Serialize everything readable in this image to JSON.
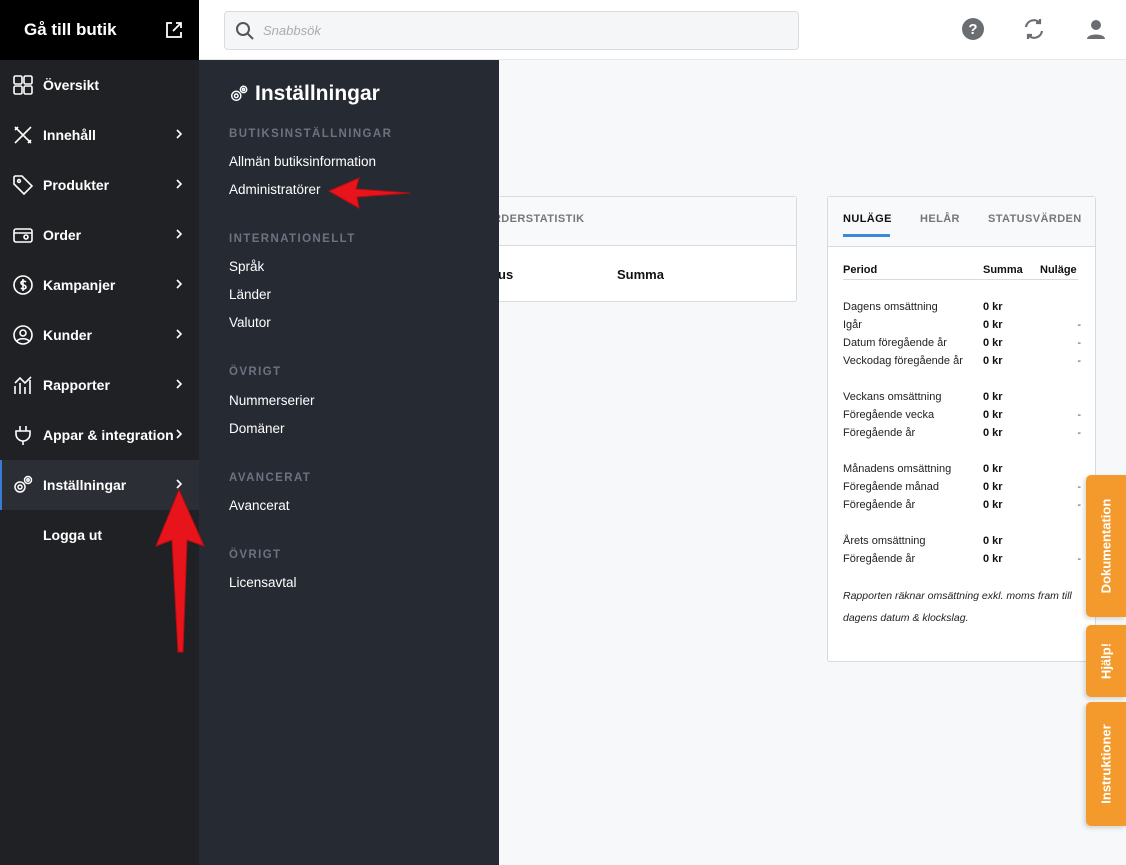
{
  "sidebar": {
    "store_link": "Gå till butik",
    "items": [
      {
        "label": "Översikt",
        "icon": "dashboard-icon",
        "has_chevron": false
      },
      {
        "label": "Innehåll",
        "icon": "pencil-ruler-icon",
        "has_chevron": true
      },
      {
        "label": "Produkter",
        "icon": "tag-icon",
        "has_chevron": true
      },
      {
        "label": "Order",
        "icon": "wallet-icon",
        "has_chevron": true
      },
      {
        "label": "Kampanjer",
        "icon": "dollar-badge-icon",
        "has_chevron": true
      },
      {
        "label": "Kunder",
        "icon": "user-circle-icon",
        "has_chevron": true
      },
      {
        "label": "Rapporter",
        "icon": "chart-icon",
        "has_chevron": true
      },
      {
        "label": "Appar & integration",
        "icon": "plug-icon",
        "has_chevron": true
      },
      {
        "label": "Inställningar",
        "icon": "gears-icon",
        "has_chevron": true,
        "active": true
      },
      {
        "label": "Logga ut",
        "icon": "",
        "has_chevron": false
      }
    ]
  },
  "search": {
    "placeholder": "Snabbsök"
  },
  "topbar_icons": [
    "help-icon",
    "sync-icon",
    "user-icon"
  ],
  "settings_menu": {
    "title": "Inställningar",
    "sections": [
      {
        "heading": "BUTIKSINSTÄLLNINGAR",
        "links": [
          "Allmän butiksinformation",
          "Administratörer"
        ]
      },
      {
        "heading": "INTERNATIONELLT",
        "links": [
          "Språk",
          "Länder",
          "Valutor"
        ]
      },
      {
        "heading": "ÖVRIGT",
        "links": [
          "Nummerserier",
          "Domäner"
        ]
      },
      {
        "heading": "AVANCERAT",
        "links": [
          "Avancerat"
        ]
      },
      {
        "heading": "ÖVRIGT",
        "links": [
          "Licensavtal"
        ]
      }
    ]
  },
  "order_stats": {
    "tab": "ORDERSTATISTIK",
    "columns": [
      "us",
      "Summa"
    ]
  },
  "sales_card": {
    "tabs": [
      "NULÄGE",
      "HELÅR",
      "STATUSVÄRDEN"
    ],
    "columns": [
      "Period",
      "Summa",
      "Nuläge"
    ],
    "rows": [
      {
        "label": "Dagens omsättning",
        "sum": "0 kr",
        "current": ""
      },
      {
        "label": "Igår",
        "sum": "0 kr",
        "current": "-"
      },
      {
        "label": "Datum föregående år",
        "sum": "0 kr",
        "current": "-"
      },
      {
        "label": "Veckodag föregående år",
        "sum": "0 kr",
        "current": "-"
      },
      {
        "label": "Veckans omsättning",
        "sum": "0 kr",
        "current": ""
      },
      {
        "label": "Föregående vecka",
        "sum": "0 kr",
        "current": "-"
      },
      {
        "label": "Föregående år",
        "sum": "0 kr",
        "current": "-"
      },
      {
        "label": "Månadens omsättning",
        "sum": "0 kr",
        "current": ""
      },
      {
        "label": "Föregående månad",
        "sum": "0 kr",
        "current": "-"
      },
      {
        "label": "Föregående år",
        "sum": "0 kr",
        "current": "-"
      },
      {
        "label": "Årets omsättning",
        "sum": "0 kr",
        "current": ""
      },
      {
        "label": "Föregående år",
        "sum": "0 kr",
        "current": "-"
      }
    ],
    "note": "Rapporten räknar omsättning exkl. moms fram till dagens datum & klockslag."
  },
  "side_tabs": [
    "Dokumentation",
    "Hjälp!",
    "Instruktioner"
  ],
  "colors": {
    "accent": "#3a8ad8",
    "orange": "#f49a2c",
    "arrow": "#e8141b"
  }
}
